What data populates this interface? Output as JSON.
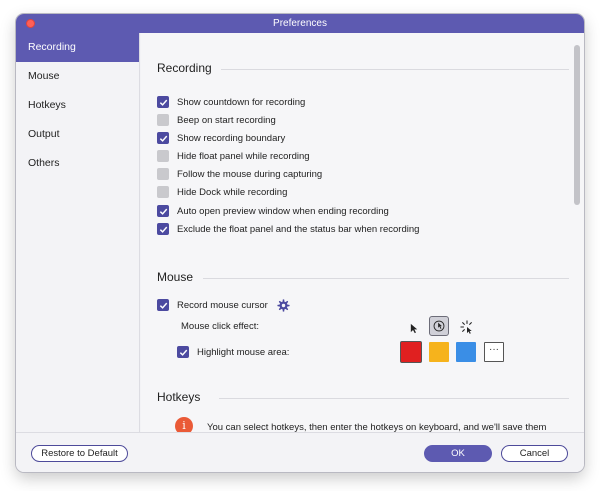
{
  "window": {
    "title": "Preferences"
  },
  "sidebar": {
    "items": [
      {
        "label": "Recording",
        "active": true
      },
      {
        "label": "Mouse"
      },
      {
        "label": "Hotkeys"
      },
      {
        "label": "Output"
      },
      {
        "label": "Others"
      }
    ]
  },
  "recording": {
    "title": "Recording",
    "options": [
      {
        "label": "Show countdown for recording",
        "checked": true
      },
      {
        "label": "Beep on start recording",
        "checked": false
      },
      {
        "label": "Show recording boundary",
        "checked": true
      },
      {
        "label": "Hide float panel while recording",
        "checked": false
      },
      {
        "label": "Follow the mouse during capturing",
        "checked": false
      },
      {
        "label": "Hide Dock while recording",
        "checked": false
      },
      {
        "label": "Auto open preview window when ending recording",
        "checked": true
      },
      {
        "label": "Exclude the float panel and the status bar when recording",
        "checked": true
      }
    ]
  },
  "mouse": {
    "title": "Mouse",
    "record_cursor": {
      "label": "Record mouse cursor",
      "checked": true
    },
    "click_effect_label": "Mouse click effect:",
    "highlight": {
      "label": "Highlight mouse area:",
      "checked": true
    },
    "highlight_colors": [
      "#e02020",
      "#f6b31c",
      "#3a8ee6"
    ],
    "more_label": "···"
  },
  "hotkeys": {
    "title": "Hotkeys",
    "info_icon": "i",
    "info_text": "You can select hotkeys, then enter the hotkeys on keyboard, and we'll save them automatically."
  },
  "footer": {
    "restore_label": "Restore to Default",
    "ok_label": "OK",
    "cancel_label": "Cancel"
  },
  "colors": {
    "accent": "#5d5ab1",
    "checkbox_checked": "#4c4aa0",
    "checkbox_unchecked": "#c9c9cd",
    "info": "#ea5a37"
  }
}
